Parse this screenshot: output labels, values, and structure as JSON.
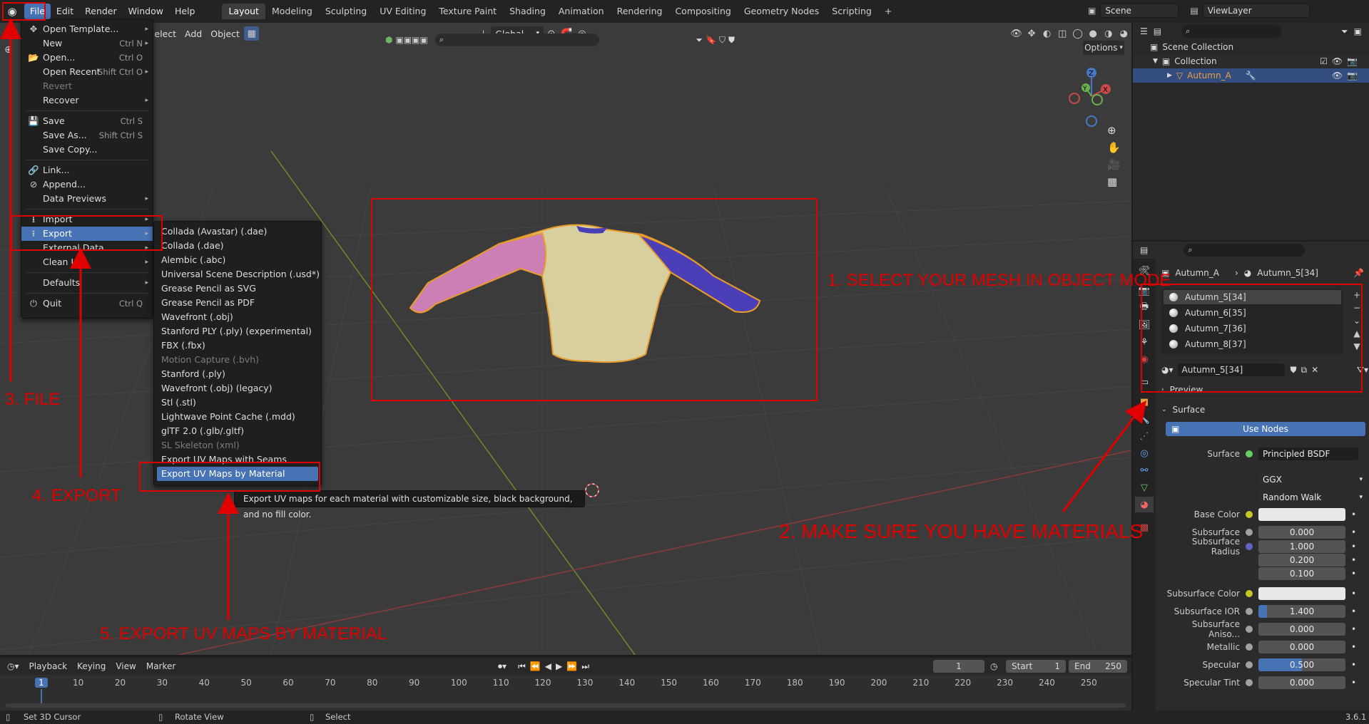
{
  "topbar": {
    "menus": [
      "File",
      "Edit",
      "Render",
      "Window",
      "Help"
    ],
    "workspaces": [
      "Layout",
      "Modeling",
      "Sculpting",
      "UV Editing",
      "Texture Paint",
      "Shading",
      "Animation",
      "Rendering",
      "Compositing",
      "Geometry Nodes",
      "Scripting",
      "+"
    ],
    "scene": "Scene",
    "view_layer": "ViewLayer"
  },
  "viewport_header": {
    "select": "elect",
    "add": "Add",
    "object": "Object",
    "orientation": "Global",
    "options": "Options"
  },
  "file_menu": [
    {
      "label": "Open Template...",
      "arrow": "▸"
    },
    {
      "label": "New",
      "shortcut": "Ctrl N",
      "arrow": "▸"
    },
    {
      "label": "Open...",
      "shortcut": "Ctrl O"
    },
    {
      "label": "Open Recent",
      "shortcut": "Shift Ctrl O",
      "arrow": "▸"
    },
    {
      "label": "Revert"
    },
    {
      "label": "Recover",
      "arrow": "▸"
    },
    {
      "label": "Save",
      "shortcut": "Ctrl S"
    },
    {
      "label": "Save As...",
      "shortcut": "Shift Ctrl S"
    },
    {
      "label": "Save Copy..."
    },
    {
      "label": "Link..."
    },
    {
      "label": "Append..."
    },
    {
      "label": "Data Previews",
      "arrow": "▸"
    },
    {
      "label": "Import",
      "arrow": "▸"
    },
    {
      "label": "Export",
      "arrow": "▸"
    },
    {
      "label": "External Data",
      "arrow": "▸"
    },
    {
      "label": "Clean Up",
      "arrow": "▸"
    },
    {
      "label": "Defaults",
      "arrow": "▸"
    },
    {
      "label": "Quit",
      "shortcut": "Ctrl Q"
    }
  ],
  "export_menu": [
    "Collada (Avastar) (.dae)",
    "Collada (.dae)",
    "Alembic (.abc)",
    "Universal Scene Description (.usd*)",
    "Grease Pencil as SVG",
    "Grease Pencil as PDF",
    "Wavefront (.obj)",
    "Stanford PLY (.ply) (experimental)",
    "FBX (.fbx)",
    "Motion Capture (.bvh)",
    "Stanford (.ply)",
    "Wavefront (.obj) (legacy)",
    "Stl (.stl)",
    "Lightwave Point Cache (.mdd)",
    "glTF 2.0 (.glb/.gltf)",
    "SL Skeleton (xml)",
    "Export UV Maps with Seams",
    "Export UV Maps by Material"
  ],
  "tooltip": "Export UV maps for each material with customizable size, black background, and no fill color.",
  "annotations": {
    "step1": "1. SELECT YOUR MESH IN OBJECT MODE",
    "step2": "2. MAKE SURE YOU HAVE MATERIALS",
    "step3": "3. FILE",
    "step4": "4. EXPORT",
    "step5": "5. EXPORT UV MAPS BY MATERIAL"
  },
  "outliner": {
    "scene_collection": "Scene Collection",
    "collection": "Collection",
    "object": "Autumn_A"
  },
  "properties": {
    "breadcrumb_object": "Autumn_A",
    "breadcrumb_material": "Autumn_5[34]",
    "material_slots": [
      "Autumn_5[34]",
      "Autumn_6[35]",
      "Autumn_7[36]",
      "Autumn_8[37]"
    ],
    "active_material": "Autumn_5[34]",
    "preview": "Preview",
    "surface_panel": "Surface",
    "use_nodes": "Use Nodes",
    "surface_label": "Surface",
    "surface_value": "Principled BSDF",
    "distribution": "GGX",
    "subsurface_method": "Random Walk",
    "rows": [
      {
        "label": "Base Color",
        "value": ""
      },
      {
        "label": "Subsurface",
        "value": "0.000"
      },
      {
        "label": "Subsurface Radius",
        "value": "1.000"
      },
      {
        "label": "",
        "value": "0.200"
      },
      {
        "label": "",
        "value": "0.100"
      },
      {
        "label": "Subsurface Color",
        "value": ""
      },
      {
        "label": "Subsurface IOR",
        "value": "1.400"
      },
      {
        "label": "Subsurface Aniso...",
        "value": "0.000"
      },
      {
        "label": "Metallic",
        "value": "0.000"
      },
      {
        "label": "Specular",
        "value": "0.500"
      },
      {
        "label": "Specular Tint",
        "value": "0.000"
      }
    ]
  },
  "timeline": {
    "menus": [
      "Playback",
      "Keying",
      "View",
      "Marker"
    ],
    "current_frame": "1",
    "start_label": "Start",
    "start": "1",
    "end_label": "End",
    "end": "250",
    "ticks": [
      "1",
      "10",
      "20",
      "30",
      "40",
      "50",
      "60",
      "70",
      "80",
      "90",
      "100",
      "110",
      "120",
      "130",
      "140",
      "150",
      "160",
      "170",
      "180",
      "190",
      "200",
      "210",
      "220",
      "230",
      "240",
      "250"
    ]
  },
  "statusbar": {
    "left": "Set 3D Cursor",
    "middle": "Rotate View",
    "right": "Select",
    "version": "3.6.1"
  },
  "colors": {
    "accent": "#4772b3",
    "annotation": "#e00000",
    "viewport": "#3b3b3b",
    "shirt_body": "#d8cf9e",
    "sleeve_left": "#cc7fb5",
    "sleeve_right": "#4b3fb8"
  }
}
